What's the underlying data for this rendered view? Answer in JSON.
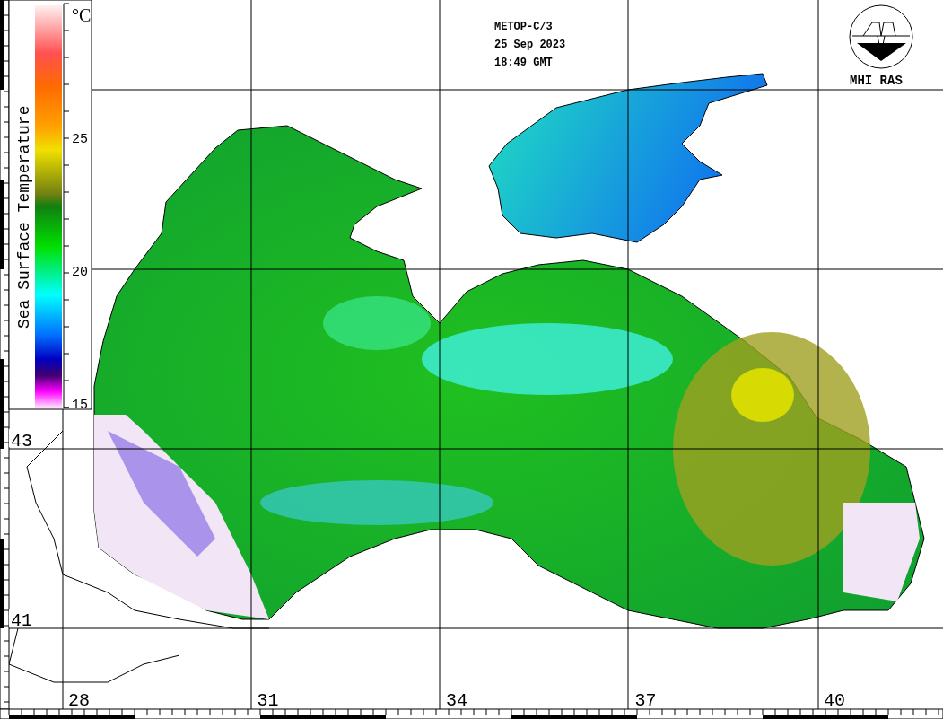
{
  "header": {
    "satellite": "METOP-C/3",
    "date": "25 Sep 2023",
    "time": "18:49 GMT"
  },
  "logo": {
    "text": "MHI RAS"
  },
  "legend": {
    "unit": "°C",
    "title": "Sea Surface Temperature",
    "ticks": [
      "25",
      "20",
      "15"
    ]
  },
  "latitude_labels": [
    "43",
    "41"
  ],
  "longitude_labels": [
    "28",
    "31",
    "34",
    "37",
    "40"
  ]
}
